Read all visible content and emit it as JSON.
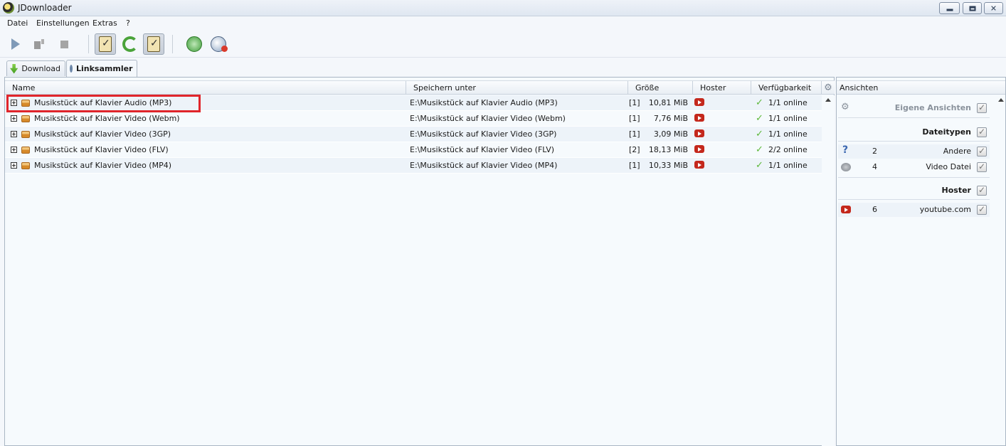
{
  "window": {
    "title": "JDownloader"
  },
  "menu": [
    "Datei",
    "Einstellungen",
    "Extras",
    "?"
  ],
  "toolbar": {
    "buttons": [
      "start-downloads",
      "pause-downloads",
      "stop-downloads",
      "clipboard-observer",
      "auto-update",
      "linkgrabber-clipboard",
      "reconnect",
      "premium"
    ]
  },
  "tabs": [
    {
      "label": "Download",
      "icon": "download-arrow-icon",
      "active": false
    },
    {
      "label": "Linksammler",
      "icon": "linkgrabber-icon",
      "active": true
    }
  ],
  "table": {
    "columns": [
      "Name",
      "Speichern unter",
      "Größe",
      "Hoster",
      "Verfügbarkeit"
    ],
    "rows": [
      {
        "name": "Musikstück auf Klavier Audio (MP3)",
        "path": "E:\\Musikstück auf Klavier Audio (MP3)",
        "count": "[1]",
        "size": "10,81 MiB",
        "hoster": "youtube",
        "availability": "1/1 online"
      },
      {
        "name": "Musikstück auf Klavier Video (Webm)",
        "path": "E:\\Musikstück auf Klavier Video (Webm)",
        "count": "[1]",
        "size": "7,76 MiB",
        "hoster": "youtube",
        "availability": "1/1 online"
      },
      {
        "name": "Musikstück auf Klavier Video (3GP)",
        "path": "E:\\Musikstück auf Klavier Video (3GP)",
        "count": "[1]",
        "size": "3,09 MiB",
        "hoster": "youtube",
        "availability": "1/1 online"
      },
      {
        "name": "Musikstück auf Klavier Video (FLV)",
        "path": "E:\\Musikstück auf Klavier Video (FLV)",
        "count": "[2]",
        "size": "18,13 MiB",
        "hoster": "youtube",
        "availability": "2/2 online"
      },
      {
        "name": "Musikstück auf Klavier Video (MP4)",
        "path": "E:\\Musikstück auf Klavier Video (MP4)",
        "count": "[1]",
        "size": "10,33 MiB",
        "hoster": "youtube",
        "availability": "1/1 online"
      }
    ]
  },
  "side": {
    "header": "Ansichten",
    "custom_views": "Eigene Ansichten",
    "filetypes_title": "Dateitypen",
    "filetypes": [
      {
        "count": "2",
        "label": "Andere",
        "icon": "question-icon"
      },
      {
        "count": "4",
        "label": "Video Datei",
        "icon": "film-reel-icon"
      }
    ],
    "hoster_title": "Hoster",
    "hosters": [
      {
        "count": "6",
        "label": "youtube.com",
        "icon": "youtube-icon"
      }
    ]
  },
  "colors": {
    "highlight": "#e0252b",
    "youtube": "#c4281c",
    "online": "#5db83a"
  }
}
